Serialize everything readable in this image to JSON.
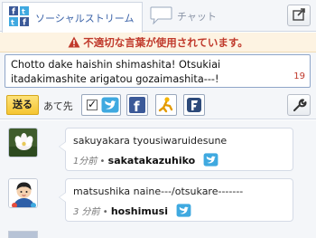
{
  "tabs": {
    "social_stream": "ソーシャルストリーム",
    "chat": "チャット"
  },
  "warning": {
    "text": "不適切な言葉が使用されています。"
  },
  "composer": {
    "message": "Chotto dake haishin shimashita! Otsukiai itadakimashite arigatou gozaimashita---!",
    "remaining_chars": "19"
  },
  "send_row": {
    "send_label": "送る",
    "destination_label": "あて先",
    "twitter_checked_mark": "✓"
  },
  "feed": {
    "posts": [
      {
        "text": "sakuyakara tyousiwaruidesune",
        "time": "1分前",
        "separator": " •",
        "user": "sakatakazuhiko"
      },
      {
        "text": "matsushika naine---/otsukare-------",
        "time": "3 分前",
        "separator": " •",
        "user": "hoshimusi"
      }
    ]
  },
  "colors": {
    "twitter_blue": "#3fa9e0",
    "facebook_blue": "#3b5998",
    "warning_red": "#c0392b",
    "send_yellow": "#f5c531"
  }
}
